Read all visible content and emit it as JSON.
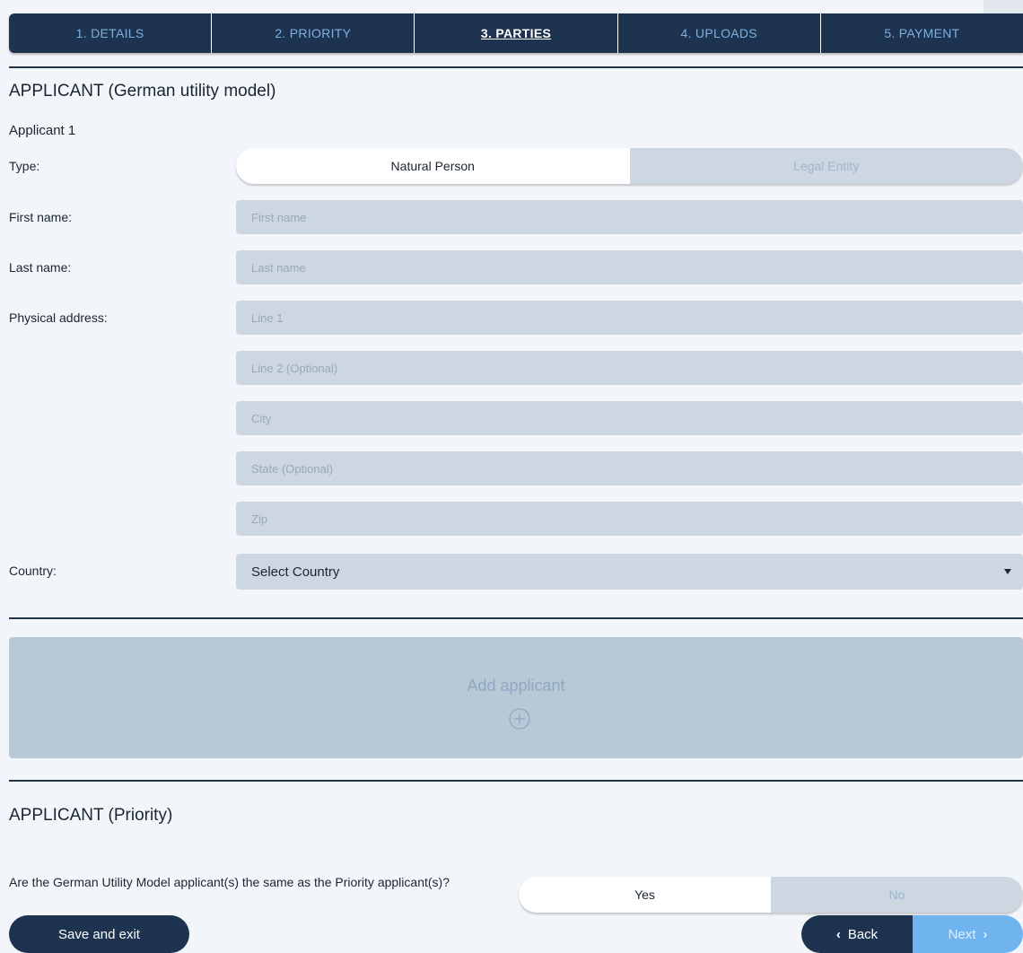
{
  "steps": [
    {
      "label": "1. DETAILS"
    },
    {
      "label": "2. PRIORITY"
    },
    {
      "label": "3. PARTIES"
    },
    {
      "label": "4. UPLOADS"
    },
    {
      "label": "5. PAYMENT"
    }
  ],
  "active_step": "3. PARTIES",
  "applicant_section": {
    "title": "APPLICANT (German utility model)",
    "subtitle": "Applicant 1",
    "type_label": "Type:",
    "type_options": [
      "Natural Person",
      "Legal Entity"
    ],
    "type_selected": "Natural Person",
    "first_name_label": "First name:",
    "first_name_placeholder": "First name",
    "first_name_value": "",
    "last_name_label": "Last name:",
    "last_name_placeholder": "Last name",
    "last_name_value": "",
    "address_label": "Physical address:",
    "address_line1_placeholder": "Line 1",
    "address_line2_placeholder": "Line 2 (Optional)",
    "city_placeholder": "City",
    "state_placeholder": "State (Optional)",
    "zip_placeholder": "Zip",
    "country_label": "Country:",
    "country_selected": "Select Country"
  },
  "add_applicant": {
    "label": "Add applicant",
    "icon": "plus-circle-icon"
  },
  "priority_section": {
    "title": "APPLICANT (Priority)",
    "question": "Are the German Utility Model applicant(s) the same as the Priority applicant(s)?",
    "options": [
      "Yes",
      "No"
    ],
    "selected": "Yes"
  },
  "footer": {
    "save_label": "Save and exit",
    "back_label": "Back",
    "next_label": "Next"
  },
  "colors": {
    "navy": "#1d3350",
    "field_bg": "#cdd7e1",
    "page_bg": "#f2f6fa",
    "next_blue": "#6fb4ef",
    "inactive_step_text": "#7fb0dc"
  }
}
